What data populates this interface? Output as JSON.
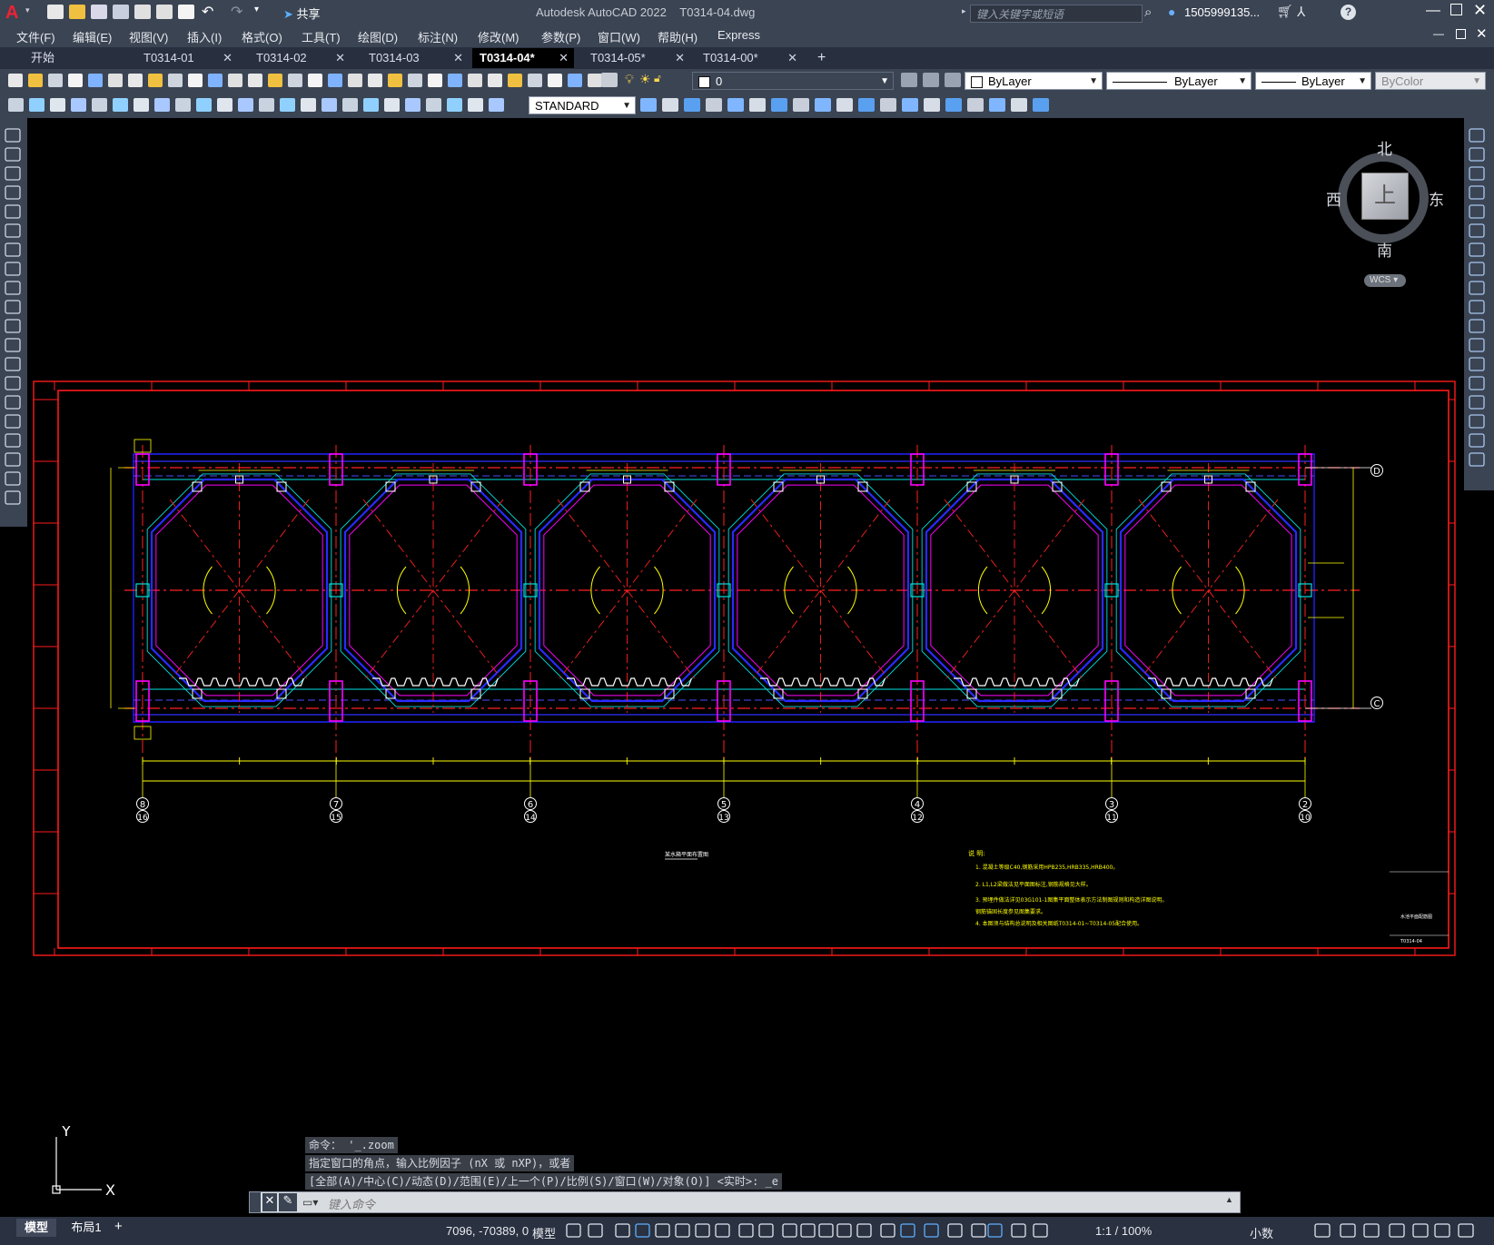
{
  "app": {
    "title": "Autodesk AutoCAD 2022",
    "file": "T0314-04.dwg",
    "share_label": "共享",
    "search_placeholder": "键入关键字或短语",
    "user": "1505999135...",
    "menu": [
      "文件(F)",
      "编辑(E)",
      "视图(V)",
      "插入(I)",
      "格式(O)",
      "工具(T)",
      "绘图(D)",
      "标注(N)",
      "修改(M)",
      "参数(P)",
      "窗口(W)",
      "帮助(H)",
      "Express"
    ]
  },
  "tabs": [
    {
      "label": "开始",
      "closable": false
    },
    {
      "label": "T0314-01",
      "closable": true
    },
    {
      "label": "T0314-02",
      "closable": true
    },
    {
      "label": "T0314-03",
      "closable": true
    },
    {
      "label": "T0314-04*",
      "closable": true,
      "active": true
    },
    {
      "label": "T0314-05*",
      "closable": true
    },
    {
      "label": "T0314-00*",
      "closable": true
    },
    {
      "label": "+",
      "closable": false
    }
  ],
  "properties": {
    "layer": "0",
    "color": "ByLayer",
    "linetype": "ByLayer",
    "lineweight": "ByLayer",
    "plotstyle": "ByColor",
    "textstyle": "STANDARD"
  },
  "viewcube": {
    "north": "北",
    "south": "南",
    "east": "东",
    "west": "西",
    "top": "上",
    "wcs": "WCS"
  },
  "drawing": {
    "grid_bubbles_bottom": [
      {
        "top": "8",
        "bottom": "16"
      },
      {
        "top": "7",
        "bottom": "15"
      },
      {
        "top": "6",
        "bottom": "14"
      },
      {
        "top": "5",
        "bottom": "13"
      },
      {
        "top": "4",
        "bottom": "12"
      },
      {
        "top": "3",
        "bottom": "11"
      },
      {
        "top": "2",
        "bottom": "10"
      }
    ],
    "grid_bubbles_right": [
      "D",
      "C"
    ],
    "plan_title": "某水箱平面布置图",
    "notes_title": "说 明:",
    "notes": [
      "1. 混凝土等级C40,钢筋采用HPB235,HRB335,HRB400。",
      "2. L1,L2梁做法见平面图标注,钢筋规格见大样。",
      "3. 预埋件做法详见03G101-1图集平面整体表示方法制图规则和构造详图说明。",
      "   钢筋锚固长度参见图集要求。",
      "4. 本图须与结构总说明及相关图纸T0314-01~T0314-05配合使用。"
    ],
    "titleblock": [
      "水池平面配筋图",
      "T0314-04"
    ]
  },
  "command": {
    "history": [
      "命令： '_.zoom",
      "指定窗口的角点，输入比例因子 (nX 或 nXP)，或者",
      "[全部(A)/中心(C)/动态(D)/范围(E)/上一个(P)/比例(S)/窗口(W)/对象(O)] <实时>: _e"
    ],
    "input_placeholder": "键入命令"
  },
  "ucs": {
    "x": "X",
    "y": "Y"
  },
  "status": {
    "layout_tabs": [
      "模型",
      "布局1",
      "+"
    ],
    "coords": "7096, -70389, 0",
    "space": "模型",
    "scale": "1:1 / 100%",
    "units": "小数"
  },
  "colors": {
    "bg": "#000000",
    "chrome": "#3b4453",
    "frame_red": "#ff1a1a",
    "axis_red": "#ff2020",
    "blue": "#1a1aff",
    "magenta": "#ff00ff",
    "yellow": "#ffff00",
    "cyan": "#00e0e0"
  }
}
